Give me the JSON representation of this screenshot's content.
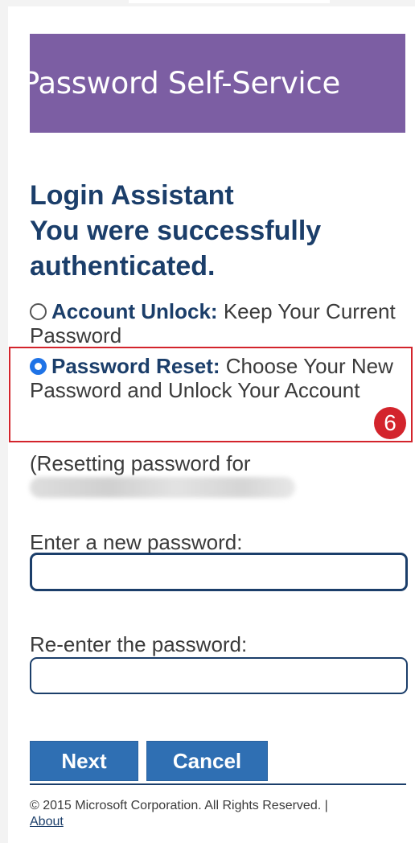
{
  "banner": {
    "title": "Password Self-Service",
    "color": "#7c5ea3"
  },
  "heading": {
    "line1": "Login Assistant",
    "line2": "You were successfully",
    "line3": "authenticated."
  },
  "options": [
    {
      "title": "Account Unlock:",
      "description": "Keep Your Current Password",
      "selected": false
    },
    {
      "title": "Password Reset:",
      "description": "Choose Your New Password and Unlock Your Account",
      "selected": true
    }
  ],
  "annotation": {
    "step_number": "6",
    "color": "#d3242c"
  },
  "resetting_text": "(Resetting password for",
  "form": {
    "new_password_label": "Enter a new password:",
    "new_password_value": "",
    "reenter_label": "Re-enter the password:",
    "reenter_value": ""
  },
  "buttons": {
    "next": "Next",
    "cancel": "Cancel",
    "color": "#2f6fb3"
  },
  "footer": {
    "copyright": "© 2015 Microsoft Corporation. All Rights Reserved.",
    "separator": "|",
    "about_link": "About"
  },
  "colors": {
    "heading": "#1b3e6a",
    "radio_selected": "#1f73e6"
  }
}
